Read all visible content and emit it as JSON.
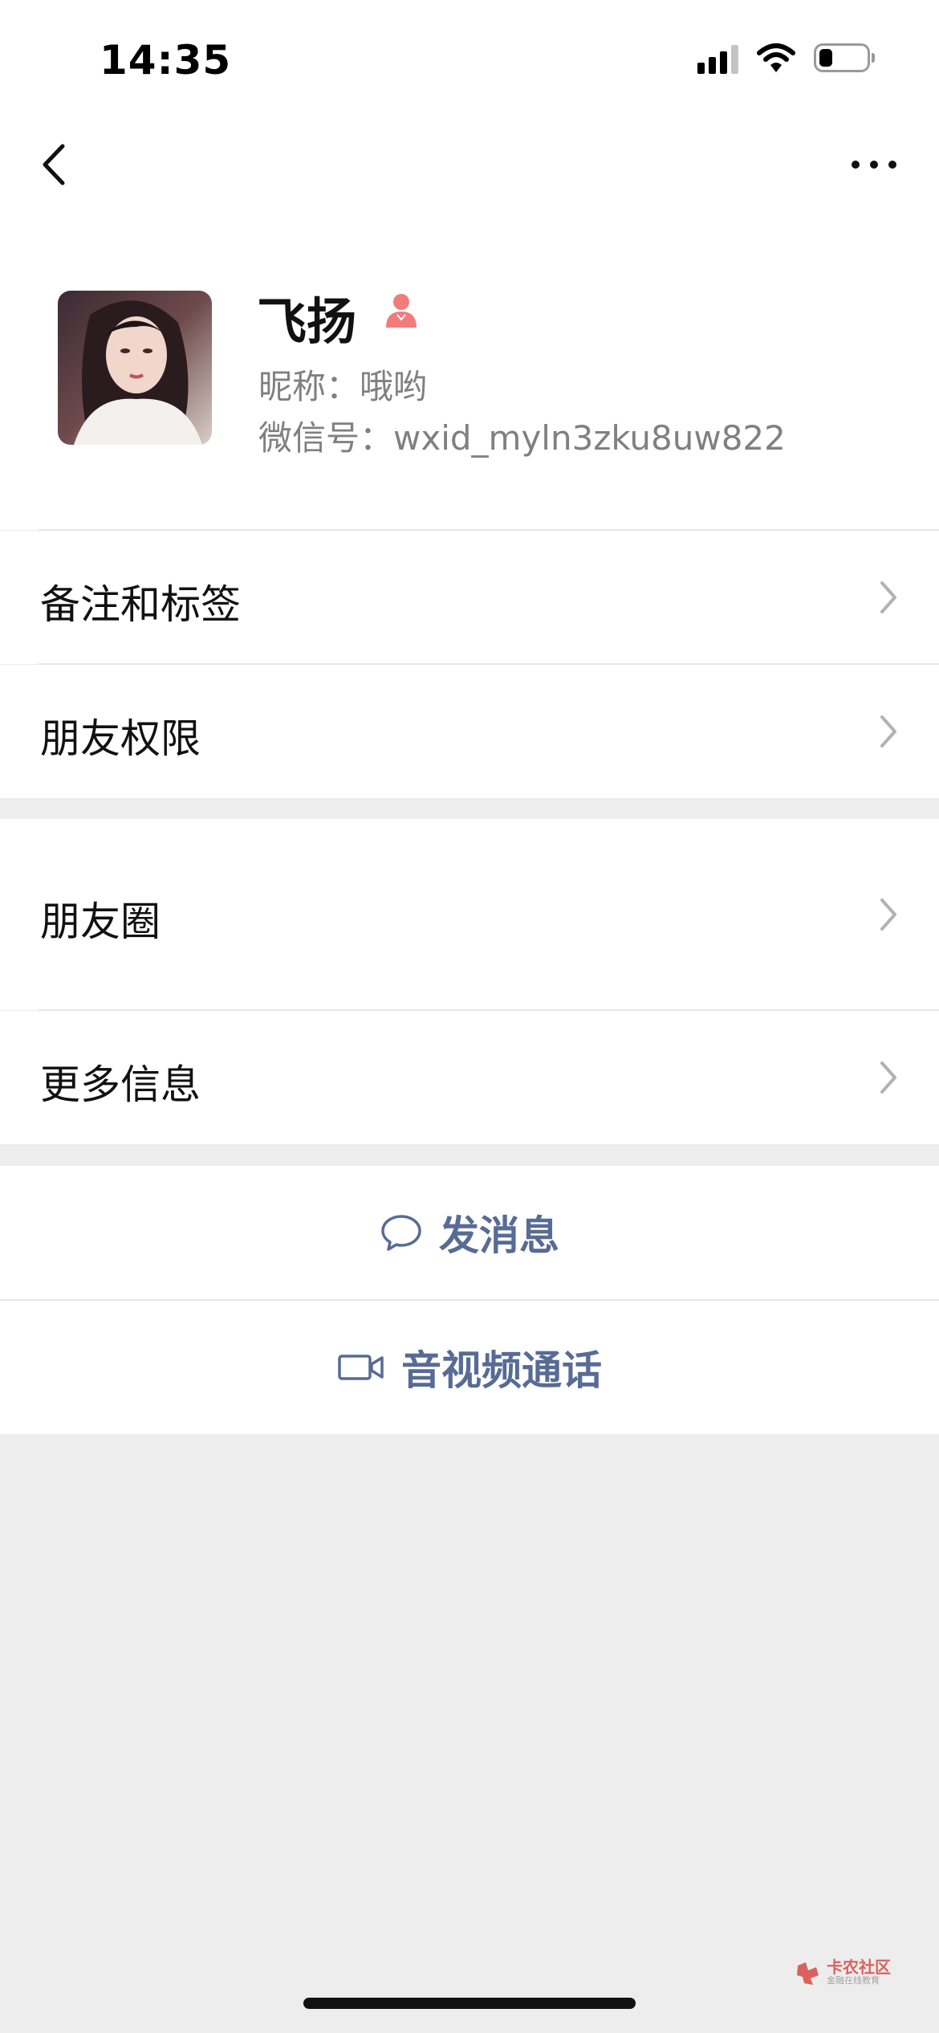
{
  "status_bar": {
    "time": "14:35",
    "icons": [
      "cellular-signal-icon",
      "wifi-icon",
      "battery-icon"
    ],
    "battery_level": 0.28
  },
  "nav": {
    "back_icon": "chevron-left-icon",
    "more_icon": "more-dots-icon"
  },
  "profile": {
    "name": "飞扬",
    "gender_icon": "female-icon",
    "nickname": "昵称：哦哟",
    "wechat_id": "微信号：wxid_myln3zku8uw822"
  },
  "list": {
    "remark_tags": "备注和标签",
    "friend_permissions": "朋友权限",
    "moments": "朋友圈",
    "more_info": "更多信息"
  },
  "actions": {
    "send_message": "发消息",
    "video_call": "音视频通话"
  },
  "watermark": {
    "title": "卡农社区",
    "subtitle": "金融在线教育"
  },
  "colors": {
    "accent": "#576b95",
    "background": "#ededed",
    "gender_icon": "#f37b7b",
    "watermark": "#d9534f"
  }
}
